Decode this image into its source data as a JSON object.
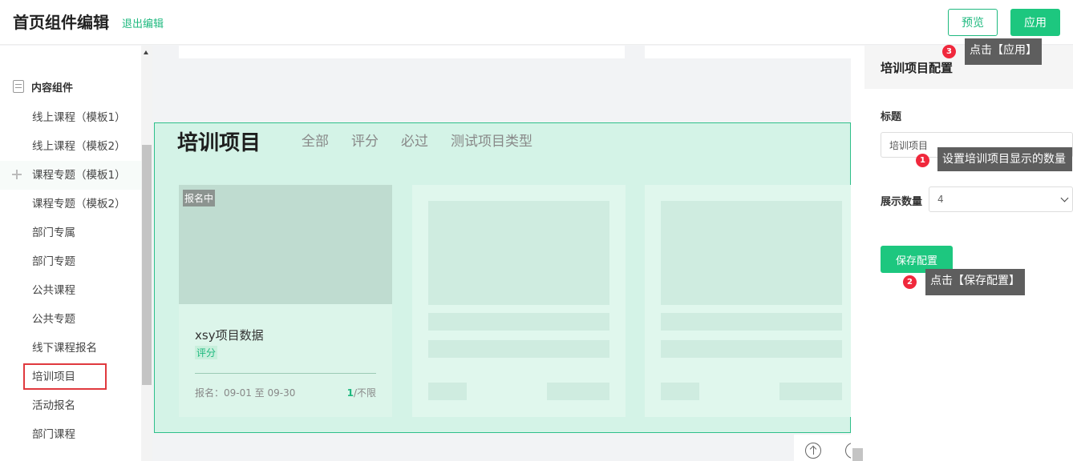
{
  "header": {
    "title": "首页组件编辑",
    "exit": "退出编辑",
    "preview": "预览",
    "apply": "应用"
  },
  "sidebar": {
    "group": "内容组件",
    "items": [
      "线上课程（模板1）",
      "线上课程（模板2）",
      "课程专题（模板1）",
      "课程专题（模板2）",
      "部门专属",
      "部门专题",
      "公共课程",
      "公共专题",
      "线下课程报名",
      "培训项目",
      "活动报名",
      "部门课程"
    ]
  },
  "module": {
    "title": "培训项目",
    "tabs": [
      "全部",
      "评分",
      "必过",
      "测试项目类型"
    ],
    "card": {
      "badge": "报名中",
      "title": "xsy项目数据",
      "tag": "评分",
      "meta": "报名：09-01 至 09-30",
      "count_current": "1",
      "count_rest": "/不限"
    }
  },
  "panel": {
    "title": "培训项目配置",
    "title_label": "标题",
    "title_value": "培训项目",
    "count_label": "展示数量",
    "count_value": "4",
    "save": "保存配置"
  },
  "tips": {
    "tip1": {
      "num": "1",
      "text": "设置培训项目显示的数量"
    },
    "tip2": {
      "num": "2",
      "text": "点击【保存配置】"
    },
    "tip3": {
      "num": "3",
      "text": "点击【应用】"
    }
  },
  "colors": {
    "accent": "#1dc77f",
    "module_bg": "#d4f3e7",
    "tip_bg": "#5e5e5e",
    "tip_num": "#f0283c",
    "highlight": "#e0393e"
  }
}
